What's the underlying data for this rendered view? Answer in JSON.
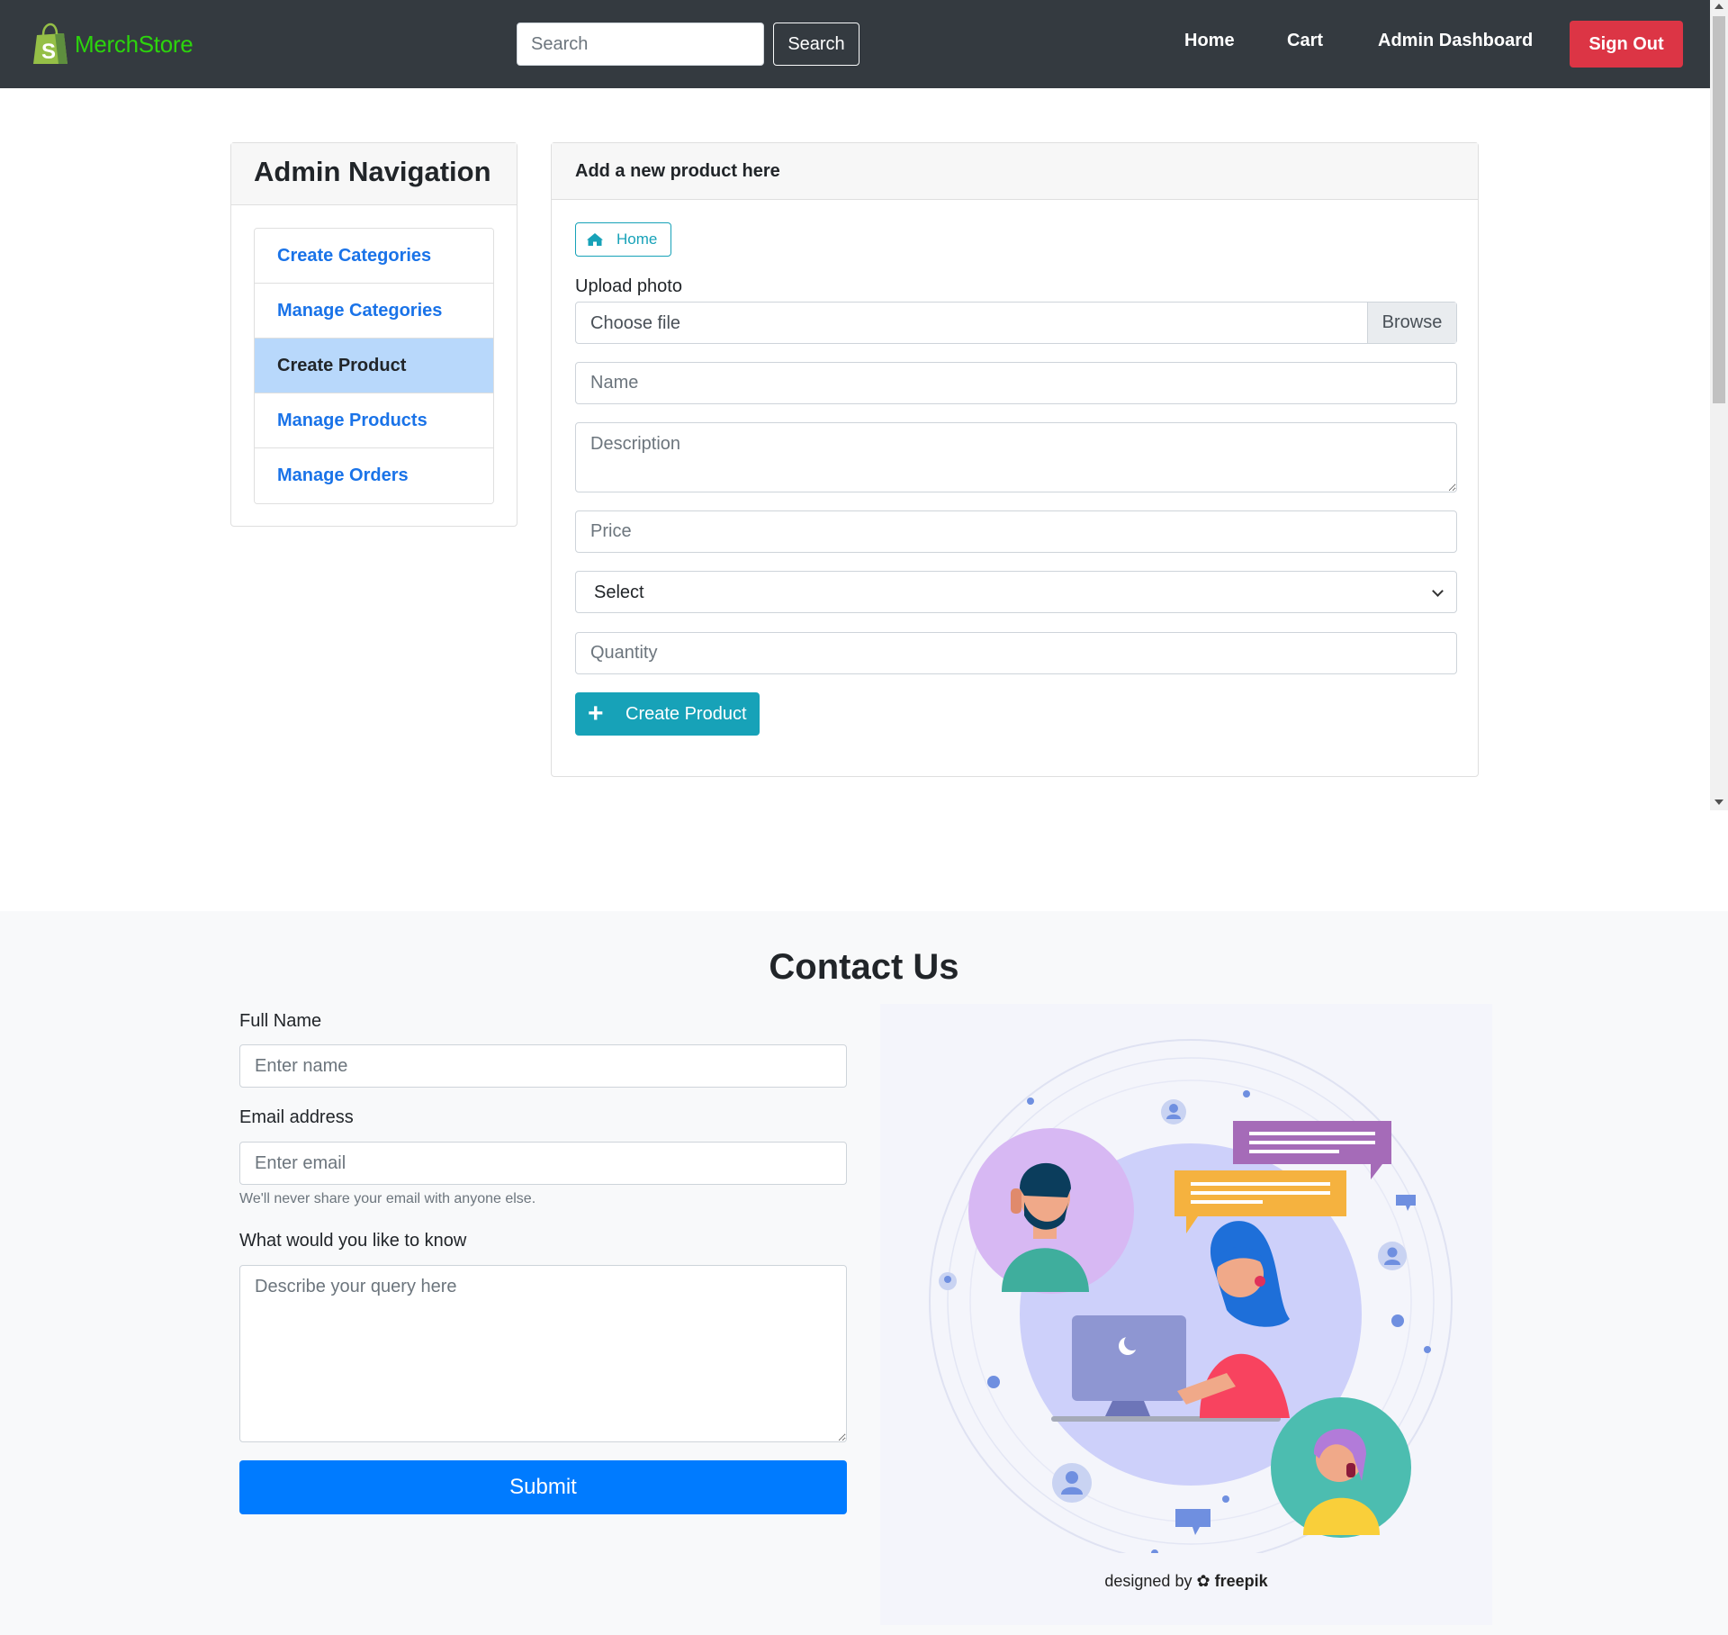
{
  "navbar": {
    "brand": "MerchStore",
    "search_placeholder": "Search",
    "search_button": "Search",
    "links": [
      "Home",
      "Cart",
      "Admin Dashboard"
    ],
    "signout": "Sign Out"
  },
  "admin_nav": {
    "title": "Admin Navigation",
    "items": [
      {
        "label": "Create Categories",
        "active": false
      },
      {
        "label": "Manage Categories",
        "active": false
      },
      {
        "label": "Create Product",
        "active": true
      },
      {
        "label": "Manage Products",
        "active": false
      },
      {
        "label": "Manage Orders",
        "active": false
      }
    ]
  },
  "product_form": {
    "header": "Add a new product here",
    "home_button": "Home",
    "upload_label": "Upload photo",
    "file_placeholder": "Choose file",
    "browse_label": "Browse",
    "name_placeholder": "Name",
    "description_placeholder": "Description",
    "price_placeholder": "Price",
    "select_value": "Select",
    "quantity_placeholder": "Quantity",
    "submit_label": "Create Product"
  },
  "contact": {
    "title": "Contact Us",
    "full_name_label": "Full Name",
    "name_placeholder": "Enter name",
    "email_label": "Email address",
    "email_placeholder": "Enter email",
    "email_help": "We'll never share your email with anyone else.",
    "query_label": "What would you like to know",
    "query_placeholder": "Describe your query here",
    "submit_label": "Submit",
    "credit_prefix": "designed by",
    "credit_brand": "freepik"
  },
  "colors": {
    "navbar_bg": "#343a40",
    "brand_green": "#2cd40c",
    "danger": "#dc3545",
    "info": "#17a2b8",
    "primary": "#007bff",
    "link_blue": "#1a73e8",
    "active_item_bg": "#b8d8fb"
  }
}
